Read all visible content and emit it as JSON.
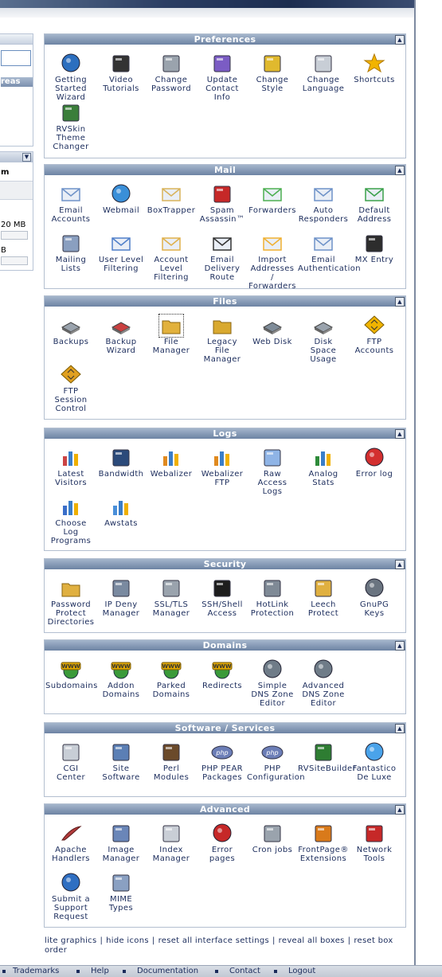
{
  "left": {
    "areas_label": "reas",
    "m_label": "m",
    "mb_label": "20 MB",
    "b_label": "B"
  },
  "panels": [
    {
      "title": "Preferences",
      "items": [
        {
          "label": "Getting\nStarted\nWizard",
          "icon": "play-icon"
        },
        {
          "label": "Video\nTutorials",
          "icon": "clapper-icon"
        },
        {
          "label": "Change\nPassword",
          "icon": "password-icon"
        },
        {
          "label": "Update\nContact\nInfo",
          "icon": "contact-icon"
        },
        {
          "label": "Change\nStyle",
          "icon": "style-icon"
        },
        {
          "label": "Change\nLanguage",
          "icon": "language-icon"
        },
        {
          "label": "Shortcuts",
          "icon": "star-icon"
        },
        {
          "label": "RVSkin\nTheme\nChanger",
          "icon": "theme-icon"
        }
      ]
    },
    {
      "title": "Mail",
      "items": [
        {
          "label": "Email\nAccounts",
          "icon": "envelope-icon"
        },
        {
          "label": "Webmail",
          "icon": "webmail-icon"
        },
        {
          "label": "BoxTrapper",
          "icon": "boxtrapper-icon"
        },
        {
          "label": "Spam\nAssassin™",
          "icon": "spamassassin-icon"
        },
        {
          "label": "Forwarders",
          "icon": "forward-icon"
        },
        {
          "label": "Auto\nResponders",
          "icon": "autoresponder-icon"
        },
        {
          "label": "Default\nAddress",
          "icon": "default-address-icon"
        },
        {
          "label": "Mailing\nLists",
          "icon": "mailing-list-icon"
        },
        {
          "label": "User Level\nFiltering",
          "icon": "user-filter-icon"
        },
        {
          "label": "Account\nLevel\nFiltering",
          "icon": "account-filter-icon"
        },
        {
          "label": "Email\nDelivery\nRoute",
          "icon": "delivery-route-icon"
        },
        {
          "label": "Import\nAddresses\n/\nForwarders",
          "icon": "import-icon"
        },
        {
          "label": "Email\nAuthentication",
          "icon": "authentication-icon"
        },
        {
          "label": "MX Entry",
          "icon": "server-icon"
        }
      ]
    },
    {
      "title": "Files",
      "items": [
        {
          "label": "Backups",
          "icon": "disk-icon"
        },
        {
          "label": "Backup\nWizard",
          "icon": "backup-wizard-icon"
        },
        {
          "label": "File\nManager",
          "icon": "folder-icon"
        },
        {
          "label": "Legacy\nFile\nManager",
          "icon": "legacy-folder-icon"
        },
        {
          "label": "Web Disk",
          "icon": "web-disk-icon"
        },
        {
          "label": "Disk\nSpace\nUsage",
          "icon": "disk-usage-icon"
        },
        {
          "label": "FTP\nAccounts",
          "icon": "ftp-icon"
        },
        {
          "label": "FTP\nSession\nControl",
          "icon": "ftp-session-icon"
        }
      ]
    },
    {
      "title": "Logs",
      "items": [
        {
          "label": "Latest\nVisitors",
          "icon": "visitors-icon"
        },
        {
          "label": "Bandwidth",
          "icon": "bandwidth-icon"
        },
        {
          "label": "Webalizer",
          "icon": "webalizer-icon"
        },
        {
          "label": "Webalizer\nFTP",
          "icon": "webalizer-ftp-icon"
        },
        {
          "label": "Raw\nAccess\nLogs",
          "icon": "raw-log-icon"
        },
        {
          "label": "Analog\nStats",
          "icon": "analog-stats-icon"
        },
        {
          "label": "Error log",
          "icon": "error-log-icon"
        },
        {
          "label": "Choose\nLog\nPrograms",
          "icon": "log-programs-icon"
        },
        {
          "label": "Awstats",
          "icon": "awstats-icon"
        }
      ]
    },
    {
      "title": "Security",
      "items": [
        {
          "label": "Password\nProtect\nDirectories",
          "icon": "protect-folder-icon"
        },
        {
          "label": "IP Deny\nManager",
          "icon": "ip-deny-icon"
        },
        {
          "label": "SSL/TLS\nManager",
          "icon": "ssl-icon"
        },
        {
          "label": "SSH/Shell\nAccess",
          "icon": "terminal-icon"
        },
        {
          "label": "HotLink\nProtection",
          "icon": "hotlink-icon"
        },
        {
          "label": "Leech\nProtect",
          "icon": "leech-icon"
        },
        {
          "label": "GnuPG\nKeys",
          "icon": "keys-icon"
        }
      ]
    },
    {
      "title": "Domains",
      "items": [
        {
          "label": "Subdomains",
          "icon": "subdomains-icon"
        },
        {
          "label": "Addon\nDomains",
          "icon": "addon-domain-icon"
        },
        {
          "label": "Parked\nDomains",
          "icon": "parked-domain-icon"
        },
        {
          "label": "Redirects",
          "icon": "redirect-icon"
        },
        {
          "label": "Simple\nDNS Zone\nEditor",
          "icon": "dns-simple-icon"
        },
        {
          "label": "Advanced\nDNS Zone\nEditor",
          "icon": "dns-advanced-icon"
        }
      ]
    },
    {
      "title": "Software / Services",
      "items": [
        {
          "label": "CGI\nCenter",
          "icon": "cgi-icon"
        },
        {
          "label": "Site\nSoftware",
          "icon": "site-software-icon"
        },
        {
          "label": "Perl\nModules",
          "icon": "camel-icon"
        },
        {
          "label": "PHP PEAR\nPackages",
          "icon": "php-pear-icon"
        },
        {
          "label": "PHP\nConfiguration",
          "icon": "php-config-icon"
        },
        {
          "label": "RVSiteBuilder",
          "icon": "sitebuilder-icon"
        },
        {
          "label": "Fantastico\nDe Luxe",
          "icon": "fantastico-icon"
        }
      ]
    },
    {
      "title": "Advanced",
      "items": [
        {
          "label": "Apache\nHandlers",
          "icon": "feather-icon"
        },
        {
          "label": "Image\nManager",
          "icon": "image-manager-icon"
        },
        {
          "label": "Index\nManager",
          "icon": "index-manager-icon"
        },
        {
          "label": "Error\npages",
          "icon": "error-pages-icon"
        },
        {
          "label": "Cron jobs",
          "icon": "cron-icon"
        },
        {
          "label": "FrontPage®\nExtensions",
          "icon": "frontpage-icon"
        },
        {
          "label": "Network\nTools",
          "icon": "toolbox-icon"
        },
        {
          "label": "Submit a\nSupport\nRequest",
          "icon": "support-icon"
        },
        {
          "label": "MIME\nTypes",
          "icon": "mime-icon"
        }
      ]
    }
  ],
  "footer_links": [
    "lite graphics",
    "hide icons",
    "reset all interface settings",
    "reveal all boxes",
    "reset box order"
  ],
  "bottom_links": [
    "Trademarks",
    "Help",
    "Documentation",
    "Contact",
    "Logout"
  ]
}
